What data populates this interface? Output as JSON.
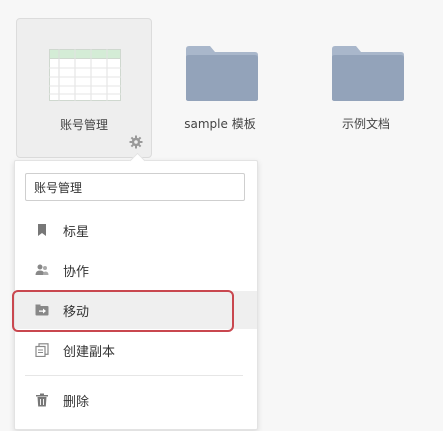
{
  "files": [
    {
      "label": "账号管理",
      "kind": "spreadsheet",
      "icon": "spreadsheet-thumbnail-icon",
      "selected": true
    },
    {
      "label": "sample 模板",
      "kind": "folder",
      "icon": "folder-icon"
    },
    {
      "label": "示例文档",
      "kind": "folder",
      "icon": "folder-icon"
    }
  ],
  "context_menu": {
    "rename_value": "账号管理",
    "items": [
      {
        "label": "标星",
        "icon": "bookmark-icon"
      },
      {
        "label": "协作",
        "icon": "users-icon"
      },
      {
        "label": "移动",
        "icon": "move-folder-icon",
        "highlighted": true
      },
      {
        "label": "创建副本",
        "icon": "copy-icon"
      },
      {
        "label": "删除",
        "icon": "trash-icon"
      }
    ]
  },
  "colors": {
    "folder": "#93a3ba",
    "folder_tab": "#a9b7cb",
    "sheet_header": "#d4ecd6",
    "highlight_outline": "#c9474f",
    "menu_hover": "#efefef"
  }
}
